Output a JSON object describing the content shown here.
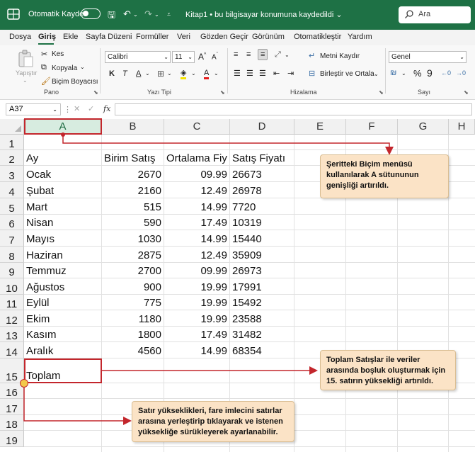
{
  "titlebar": {
    "autosave_label": "Otomatik Kaydet",
    "document_title": "Kitap1 • bu bilgisayar konumuna kaydedildi ⌄",
    "search_placeholder": "Ara",
    "bg_color": "#1e7145"
  },
  "menu": {
    "tabs": [
      "Dosya",
      "Giriş",
      "Ekle",
      "Sayfa Düzeni",
      "Formüller",
      "Veri",
      "Gözden Geçir",
      "Görünüm",
      "Otomatikleştir",
      "Yardım"
    ],
    "active": "Giriş"
  },
  "ribbon": {
    "clipboard": {
      "paste": "Yapıştır",
      "cut": "Kes",
      "copy": "Kopyala",
      "format_painter": "Biçim Boyacısı",
      "group": "Pano"
    },
    "font": {
      "name": "Calibri",
      "size": "11",
      "bold": "K",
      "italic": "T",
      "underline": "A",
      "group": "Yazı Tipi"
    },
    "alignment": {
      "wrap": "Metni Kaydır",
      "merge": "Birleştir ve Ortala",
      "group": "Hizalama"
    },
    "number": {
      "format": "Genel",
      "percent": "%",
      "comma": "9",
      "group": "Sayı"
    }
  },
  "formula_bar": {
    "name_box": "A37",
    "fx": "fx"
  },
  "sheet": {
    "columns": [
      "A",
      "B",
      "C",
      "D",
      "E",
      "F",
      "G",
      "H"
    ],
    "selected_column": "A",
    "row_numbers": [
      "1",
      "2",
      "3",
      "4",
      "5",
      "6",
      "7",
      "8",
      "9",
      "10",
      "11",
      "12",
      "13",
      "14",
      "15",
      "16",
      "17",
      "18",
      "19"
    ],
    "headers": [
      "Ay",
      "Birim Satış",
      "Ortalama Fiyat",
      "Satış Fiyatı"
    ],
    "rows": [
      [
        "Ocak",
        "2670",
        "09.99",
        "26673"
      ],
      [
        "Şubat",
        "2160",
        "12.49",
        "26978"
      ],
      [
        "Mart",
        "515",
        "14.99",
        "7720"
      ],
      [
        "Nisan",
        "590",
        "17.49",
        "10319"
      ],
      [
        "Mayıs",
        "1030",
        "14.99",
        "15440"
      ],
      [
        "Haziran",
        "2875",
        "12.49",
        "35909"
      ],
      [
        "Temmuz",
        "2700",
        "09.99",
        "26973"
      ],
      [
        "Ağustos",
        "900",
        "19.99",
        "17991"
      ],
      [
        "Eylül",
        "775",
        "19.99",
        "15492"
      ],
      [
        "Ekim",
        "1180",
        "19.99",
        "23588"
      ],
      [
        "Kasım",
        "1800",
        "17.49",
        "31482"
      ],
      [
        "Aralık",
        "4560",
        "14.99",
        "68354"
      ]
    ],
    "total_label": "Toplam"
  },
  "callouts": {
    "column_width": "Şeritteki Biçim menüsü kullanılarak A sütununun genişliği artırıldı.",
    "row_height": "Toplam Satışlar ile veriler arasında boşluk oluşturmak için 15. satırın yüksekliği artırıldı.",
    "drag_tip": "Satır yükseklikleri, fare imlecini satırlar arasına yerleştirip tıklayarak ve istenen yüksekliğe sürükleyerek ayarlanabilir."
  },
  "colors": {
    "accent": "#1e7145",
    "annotation_red": "#c3262c",
    "callout_fill": "#fbe3c6",
    "marker_yellow": "#f2c84b"
  }
}
